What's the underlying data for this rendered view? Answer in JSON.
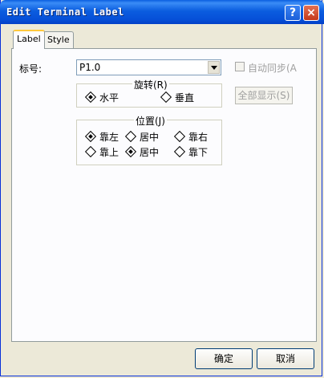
{
  "window": {
    "title": "Edit Terminal Label",
    "help_glyph": "?",
    "close_glyph": "×"
  },
  "tabs": [
    {
      "label": "Label",
      "active": true
    },
    {
      "label": "Style",
      "active": false
    }
  ],
  "label_field": {
    "label": "标号:",
    "value": "P1.0"
  },
  "auto_sync": {
    "label": "自动同步(A",
    "checked": false,
    "enabled": false
  },
  "show_all_button": {
    "label": "全部显示(S)",
    "enabled": false
  },
  "rotation": {
    "title": "旋转(R)",
    "options": [
      {
        "label": "水平",
        "selected": true
      },
      {
        "label": "垂直",
        "selected": false
      }
    ]
  },
  "position": {
    "title": "位置(J)",
    "options": [
      {
        "label": "靠左",
        "selected": true
      },
      {
        "label": "居中",
        "selected": false
      },
      {
        "label": "靠右",
        "selected": false
      },
      {
        "label": "靠上",
        "selected": false
      },
      {
        "label": "居中",
        "selected": true
      },
      {
        "label": "靠下",
        "selected": false
      }
    ]
  },
  "footer": {
    "ok_label": "确定",
    "cancel_label": "取消"
  }
}
